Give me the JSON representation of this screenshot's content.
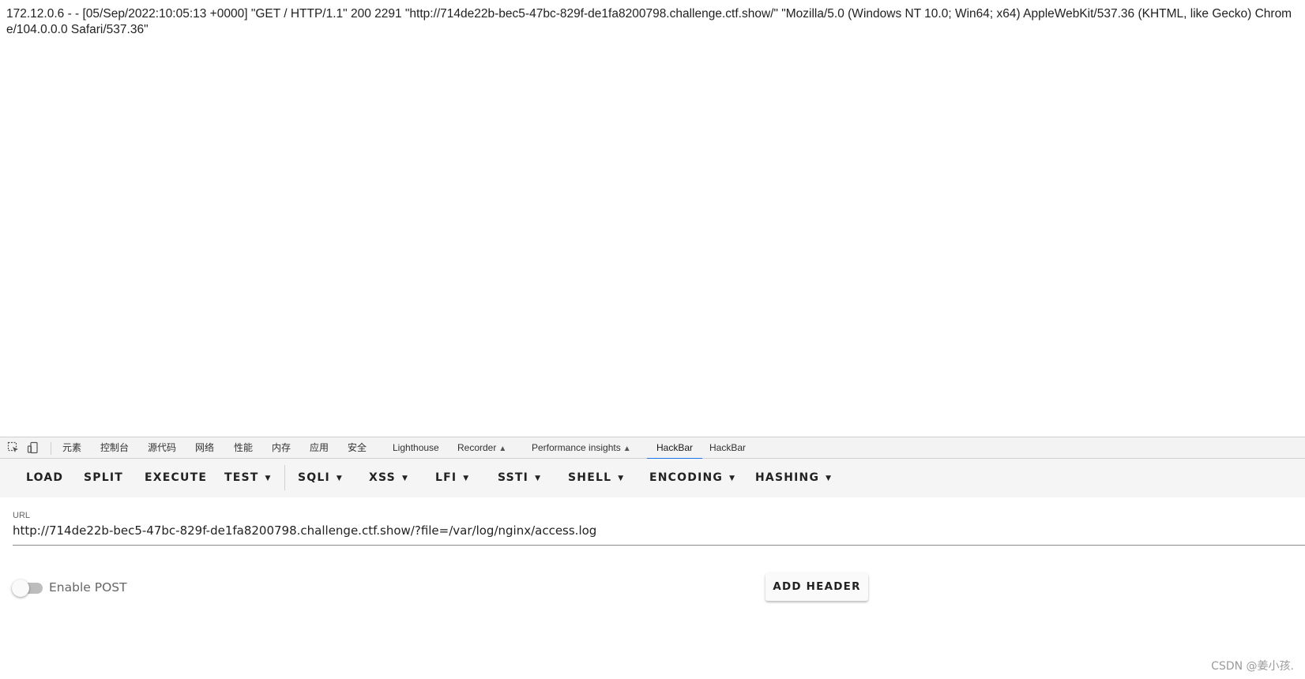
{
  "page": {
    "log_text": "172.12.0.6 - - [05/Sep/2022:10:05:13 +0000] \"GET / HTTP/1.1\" 200 2291 \"http://714de22b-bec5-47bc-829f-de1fa8200798.challenge.ctf.show/\" \"Mozilla/5.0 (Windows NT 10.0; Win64; x64) AppleWebKit/537.36 (KHTML, like Gecko) Chrome/104.0.0.0 Safari/537.36\""
  },
  "devtools": {
    "icons": [
      "inspect-icon",
      "device-toolbar-icon"
    ],
    "tabs": [
      {
        "label": "元素"
      },
      {
        "label": "控制台"
      },
      {
        "label": "源代码"
      },
      {
        "label": "网络"
      },
      {
        "label": "性能"
      },
      {
        "label": "内存"
      },
      {
        "label": "应用"
      },
      {
        "label": "安全"
      },
      {
        "label": "Lighthouse"
      },
      {
        "label": "Recorder"
      },
      {
        "label": "Performance insights"
      },
      {
        "label": "HackBar"
      },
      {
        "label": "HackBar"
      }
    ],
    "active_tab": "HackBar",
    "accent_color": "#1a73e8"
  },
  "hackbar": {
    "buttons": [
      {
        "label": "LOAD"
      },
      {
        "label": "SPLIT"
      },
      {
        "label": "EXECUTE"
      },
      {
        "label": "TEST"
      },
      {
        "label": "SQLI"
      },
      {
        "label": "XSS"
      },
      {
        "label": "LFI"
      },
      {
        "label": "SSTI"
      },
      {
        "label": "SHELL"
      },
      {
        "label": "ENCODING"
      },
      {
        "label": "HASHING"
      }
    ],
    "url_label": "URL",
    "url_value": "http://714de22b-bec5-47bc-829f-de1fa8200798.challenge.ctf.show/?file=/var/log/nginx/access.log",
    "enable_post_label": "Enable POST",
    "enable_post_on": false,
    "add_header_label": "ADD HEADER"
  },
  "watermark": "CSDN @姜小孩."
}
